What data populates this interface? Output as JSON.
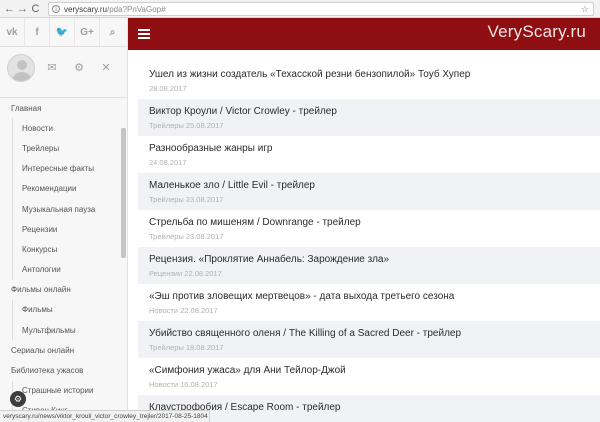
{
  "browser": {
    "url_domain": "veryscary.ru",
    "url_path": "/pda?PnVaGop#",
    "back_icon": "←",
    "forward_icon": "→",
    "reload_icon": "C",
    "star_icon": "☆",
    "info_icon": "i"
  },
  "social": [
    {
      "name": "vk-icon",
      "glyph": "vk"
    },
    {
      "name": "facebook-icon",
      "glyph": "f"
    },
    {
      "name": "twitter-icon",
      "glyph": "🐦"
    },
    {
      "name": "google-plus-icon",
      "glyph": "G+"
    },
    {
      "name": "search-icon",
      "glyph": "⌕"
    }
  ],
  "user_actions": {
    "mail_icon": "✉",
    "settings_icon": "⚙",
    "close_icon": "✕"
  },
  "sidebar_menu": [
    {
      "label": "Главная",
      "level": 0
    },
    {
      "label": "Новости",
      "level": 1
    },
    {
      "label": "Трейлеры",
      "level": 1
    },
    {
      "label": "Интересные факты",
      "level": 1
    },
    {
      "label": "Рекомендации",
      "level": 1
    },
    {
      "label": "Музыкальная пауза",
      "level": 1
    },
    {
      "label": "Рецензии",
      "level": 1
    },
    {
      "label": "Конкурсы",
      "level": 1
    },
    {
      "label": "Антологии",
      "level": 1
    },
    {
      "label": "Фильмы онлайн",
      "level": 0
    },
    {
      "label": "Фильмы",
      "level": 1
    },
    {
      "label": "Мультфильмы",
      "level": 1
    },
    {
      "label": "Сериалы онлайн",
      "level": 0
    },
    {
      "label": "Библиотека ужасов",
      "level": 0
    },
    {
      "label": "Страшные истории",
      "level": 1
    },
    {
      "label": "Стивен Кинг",
      "level": 1
    }
  ],
  "header": {
    "brand": "VeryScary.ru"
  },
  "articles": [
    {
      "title": "Ушел из жизни создатель «Техасской резни бензопилой» Тоуб Хупер",
      "meta": "28.08.2017"
    },
    {
      "title": "Виктор Кроули / Victor Crowley - трейлер",
      "meta": "Трейлеры 25.08.2017"
    },
    {
      "title": "Разнообразные жанры игр",
      "meta": "24.08.2017"
    },
    {
      "title": "Маленькое зло / Little Evil - трейлер",
      "meta": "Трейлеры 23.08.2017"
    },
    {
      "title": "Стрельба по мишеням / Downrange - трейлер",
      "meta": "Трейлеры 23.08.2017"
    },
    {
      "title": "Рецензия. «Проклятие Аннабель: Зарождение зла»",
      "meta": "Рецензии 22.08.2017"
    },
    {
      "title": "«Эш против зловещих мертвецов» - дата выхода третьего сезона",
      "meta": "Новости 22.08.2017"
    },
    {
      "title": "Убийство священного оленя / The Killing of a Sacred Deer - трейлер",
      "meta": "Трейлеры 18.08.2017"
    },
    {
      "title": "«Симфония ужаса» для Ани Тейлор-Джой",
      "meta": "Новости 16.08.2017"
    },
    {
      "title": "Клаустрофобия / Escape Room - трейлер",
      "meta": ""
    }
  ],
  "status_bar": {
    "url": "veryscary.ru/news/viktor_krouli_victor_crowley_trejler/2017-08-25-1804"
  },
  "float_button_icon": "⚙"
}
